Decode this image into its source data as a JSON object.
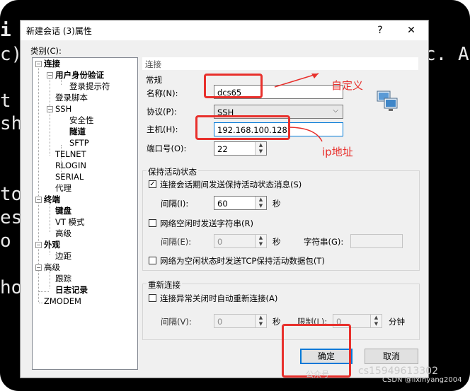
{
  "terminal": {
    "lines": [
      "i",
      "c)",
      "",
      "t",
      "sh",
      "",
      "",
      "to",
      "es",
      "o",
      "",
      "ho"
    ],
    "right_text": "c. A"
  },
  "dialog": {
    "title": "新建会话 (3)属性",
    "help": "?",
    "close": "✕",
    "category_label": "类别(C):",
    "tree": {
      "connection": "连接",
      "user_auth": "用户身份验证",
      "login_prompt": "登录提示符",
      "login_script": "登录脚本",
      "ssh": "SSH",
      "security": "安全性",
      "tunnel": "隧道",
      "sftp": "SFTP",
      "telnet": "TELNET",
      "rlogin": "RLOGIN",
      "serial": "SERIAL",
      "proxy": "代理",
      "terminal": "终端",
      "keyboard": "键盘",
      "vt_mode": "VT 模式",
      "advanced": "高级",
      "appearance": "外观",
      "margin": "边距",
      "advanced2": "高级",
      "trace": "跟踪",
      "log": "日志记录",
      "zmodem": "ZMODEM"
    },
    "section_header": "连接",
    "general": {
      "title": "常规",
      "name_label": "名称(N):",
      "name_value": "dcs65",
      "protocol_label": "协议(P):",
      "protocol_value": "SSH",
      "host_label": "主机(H):",
      "host_value": "192.168.100.128",
      "port_label": "端口号(O):",
      "port_value": "22"
    },
    "keepalive": {
      "title": "保持活动状态",
      "send_msg": "连接会话期间发送保持活动状态消息(S)",
      "interval_label": "间隔(I):",
      "interval_value": "60",
      "sec": "秒",
      "send_str": "网络空闲时发送字符串(R)",
      "interval2_label": "间隔(E):",
      "interval2_value": "0",
      "sec2": "秒",
      "string_label": "字符串(G):",
      "tcp": "网络为空闲状态时发送TCP保持活动数据包(T)"
    },
    "reconnect": {
      "title": "重新连接",
      "auto": "连接异常关闭时自动重新连接(A)",
      "interval_label": "间隔(V):",
      "interval_value": "0",
      "sec": "秒",
      "limit_label": "限制(L):",
      "limit_value": "0",
      "min": "分钟"
    },
    "ok": "确定",
    "cancel": "取消"
  },
  "annotations": {
    "custom": "自定义",
    "ip": "ip地址"
  },
  "watermark": {
    "left": "公众号",
    "right": "cs15949613302",
    "csdn": "CSDN @lixinyang2004"
  },
  "colors": {
    "annotation": "#e8302c",
    "accent": "#0078d7"
  }
}
